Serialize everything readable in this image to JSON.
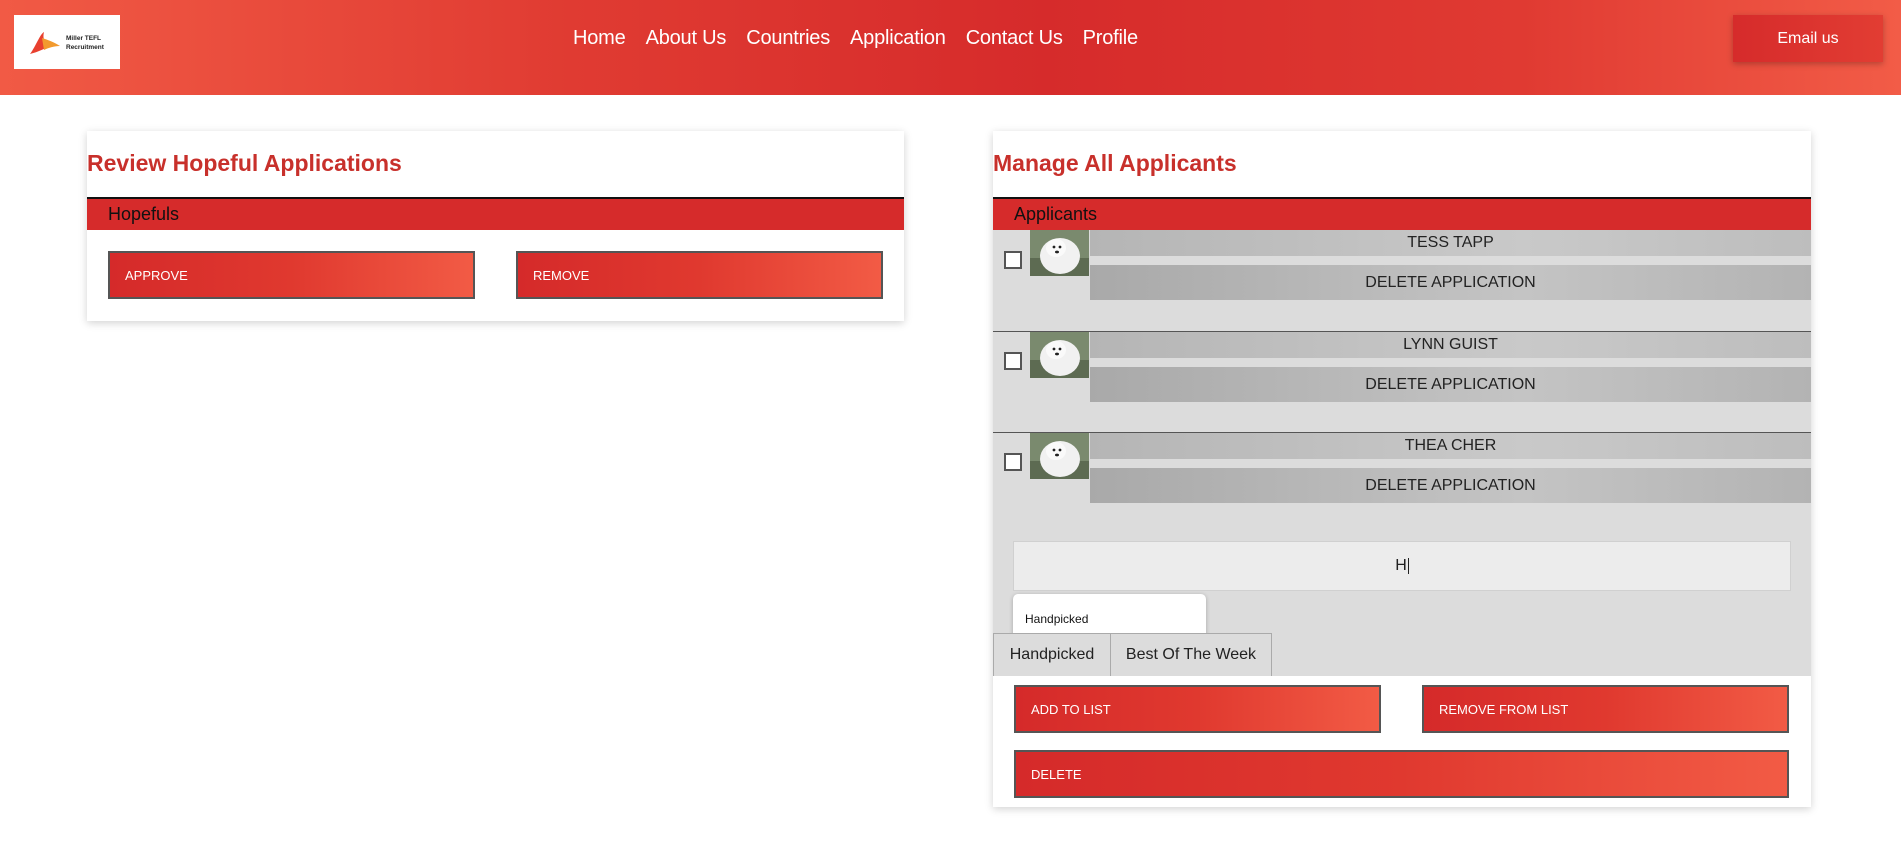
{
  "header": {
    "logo_line1": "Miller TEFL",
    "logo_line2": "Recruitment",
    "nav": [
      "Home",
      "About Us",
      "Countries",
      "Application",
      "Contact Us",
      "Profile"
    ],
    "email_button": "Email us"
  },
  "review": {
    "title": "Review Hopeful Applications",
    "section": "Hopefuls",
    "approve_label": "APPROVE",
    "remove_label": "REMOVE"
  },
  "manage": {
    "title": "Manage All Applicants",
    "section": "Applicants",
    "applicants": [
      {
        "name": "TESS TAPP",
        "delete_label": "DELETE APPLICATION",
        "checked": false
      },
      {
        "name": "LYNN GUIST",
        "delete_label": "DELETE APPLICATION",
        "checked": false
      },
      {
        "name": "THEA CHER",
        "delete_label": "DELETE APPLICATION",
        "checked": false
      }
    ],
    "list_input_value": "H",
    "suggestion": "Handpicked",
    "tabs": [
      "Handpicked",
      "Best Of The Week"
    ],
    "add_label": "ADD TO LIST",
    "remove_label": "REMOVE FROM LIST",
    "delete_label": "DELETE"
  },
  "colors": {
    "accent": "#d62b2b",
    "title": "#c8302b",
    "gray_panel": "#dcdcdc"
  }
}
